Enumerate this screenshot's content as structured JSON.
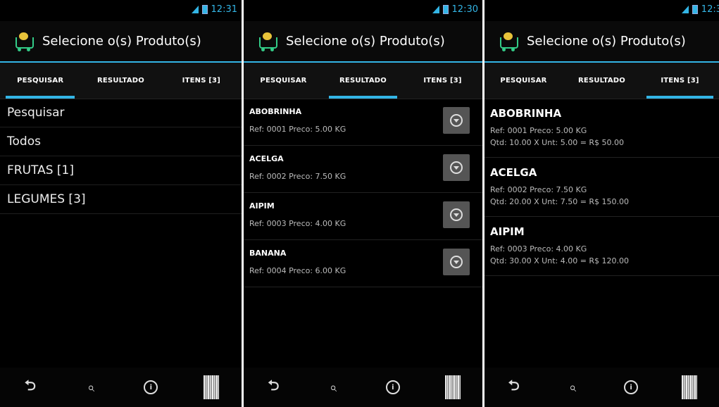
{
  "app_title": "Selecione o(s) Produto(s)",
  "tabs": [
    "PESQUISAR",
    "RESULTADO",
    "ITENS [3]"
  ],
  "icons": {
    "app": "shopping-cart-fruit-icon",
    "back": "back-icon",
    "search": "search-icon",
    "info": "info-icon",
    "barcode": "barcode-icon",
    "expand": "chevron-circle-down-icon"
  },
  "colors": {
    "accent": "#33b5e5",
    "background": "#000000"
  },
  "screens": [
    {
      "time": "12:31",
      "active_tab": 0,
      "search_items": [
        "Pesquisar",
        "Todos",
        "FRUTAS [1]",
        "LEGUMES [3]"
      ]
    },
    {
      "time": "12:30",
      "active_tab": 1,
      "results": [
        {
          "name": "ABOBRINHA",
          "info": "Ref: 0001  Preco: 5.00 KG"
        },
        {
          "name": "ACELGA",
          "info": "Ref: 0002  Preco: 7.50 KG"
        },
        {
          "name": "AIPIM",
          "info": "Ref: 0003  Preco: 4.00 KG"
        },
        {
          "name": "BANANA",
          "info": "Ref: 0004  Preco: 6.00 KG"
        }
      ]
    },
    {
      "time": "12:3",
      "active_tab": 2,
      "items": [
        {
          "name": "ABOBRINHA",
          "info": "Ref: 0001  Preco: 5.00 KG",
          "qty": "Qtd: 10.00 X Unt: 5.00 = R$ 50.00"
        },
        {
          "name": "ACELGA",
          "info": "Ref: 0002  Preco: 7.50 KG",
          "qty": "Qtd: 20.00 X Unt: 7.50 = R$ 150.00"
        },
        {
          "name": "AIPIM",
          "info": "Ref: 0003  Preco: 4.00 KG",
          "qty": "Qtd: 30.00 X Unt: 4.00 = R$ 120.00"
        }
      ]
    }
  ]
}
